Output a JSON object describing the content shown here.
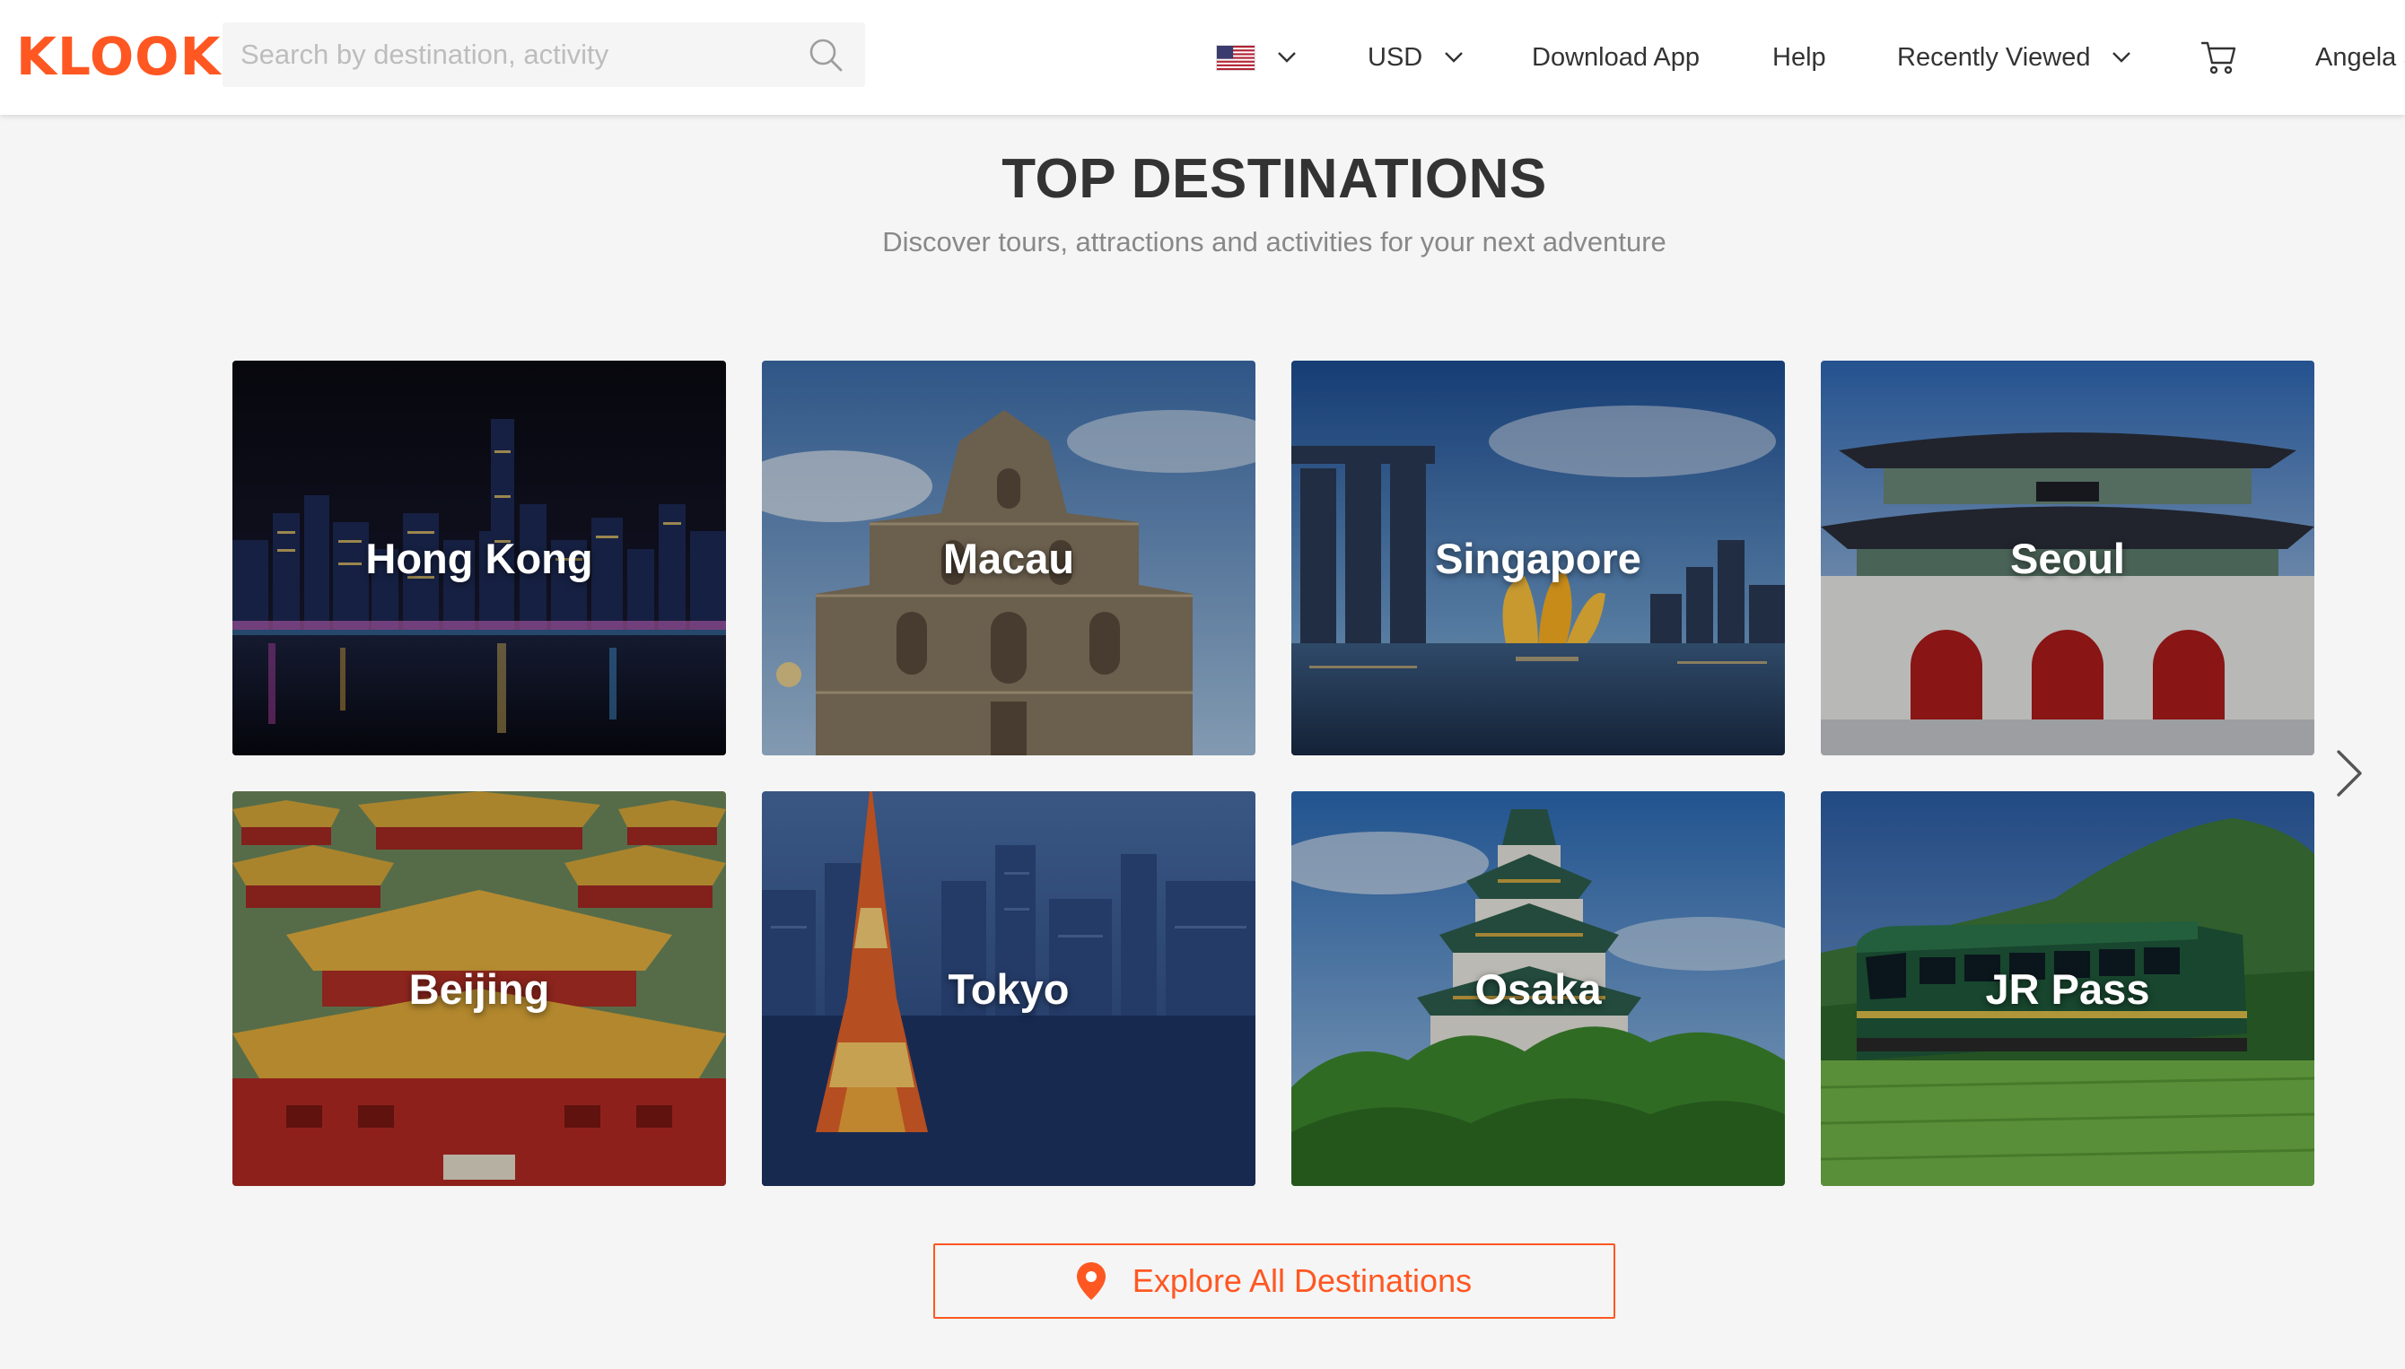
{
  "header": {
    "logo": "KLOOK",
    "search": {
      "placeholder": "Search by destination, activity",
      "value": ""
    },
    "flag_icon": "us-flag-icon",
    "currency": "USD",
    "download_app": "Download App",
    "help": "Help",
    "recently_viewed": "Recently Viewed",
    "cart_icon": "cart-icon",
    "user": "Angela S"
  },
  "section": {
    "title": "TOP DESTINATIONS",
    "subtitle": "Discover tours, attractions and activities for your next adventure"
  },
  "destinations": [
    {
      "name": "Hong Kong"
    },
    {
      "name": "Macau"
    },
    {
      "name": "Singapore"
    },
    {
      "name": "Seoul"
    },
    {
      "name": "Beijing"
    },
    {
      "name": "Tokyo"
    },
    {
      "name": "Osaka"
    },
    {
      "name": "JR Pass"
    }
  ],
  "explore_button": "Explore All Destinations",
  "colors": {
    "brand": "#ff5722",
    "background": "#f5f5f5",
    "text": "#333333",
    "muted": "#888888"
  }
}
